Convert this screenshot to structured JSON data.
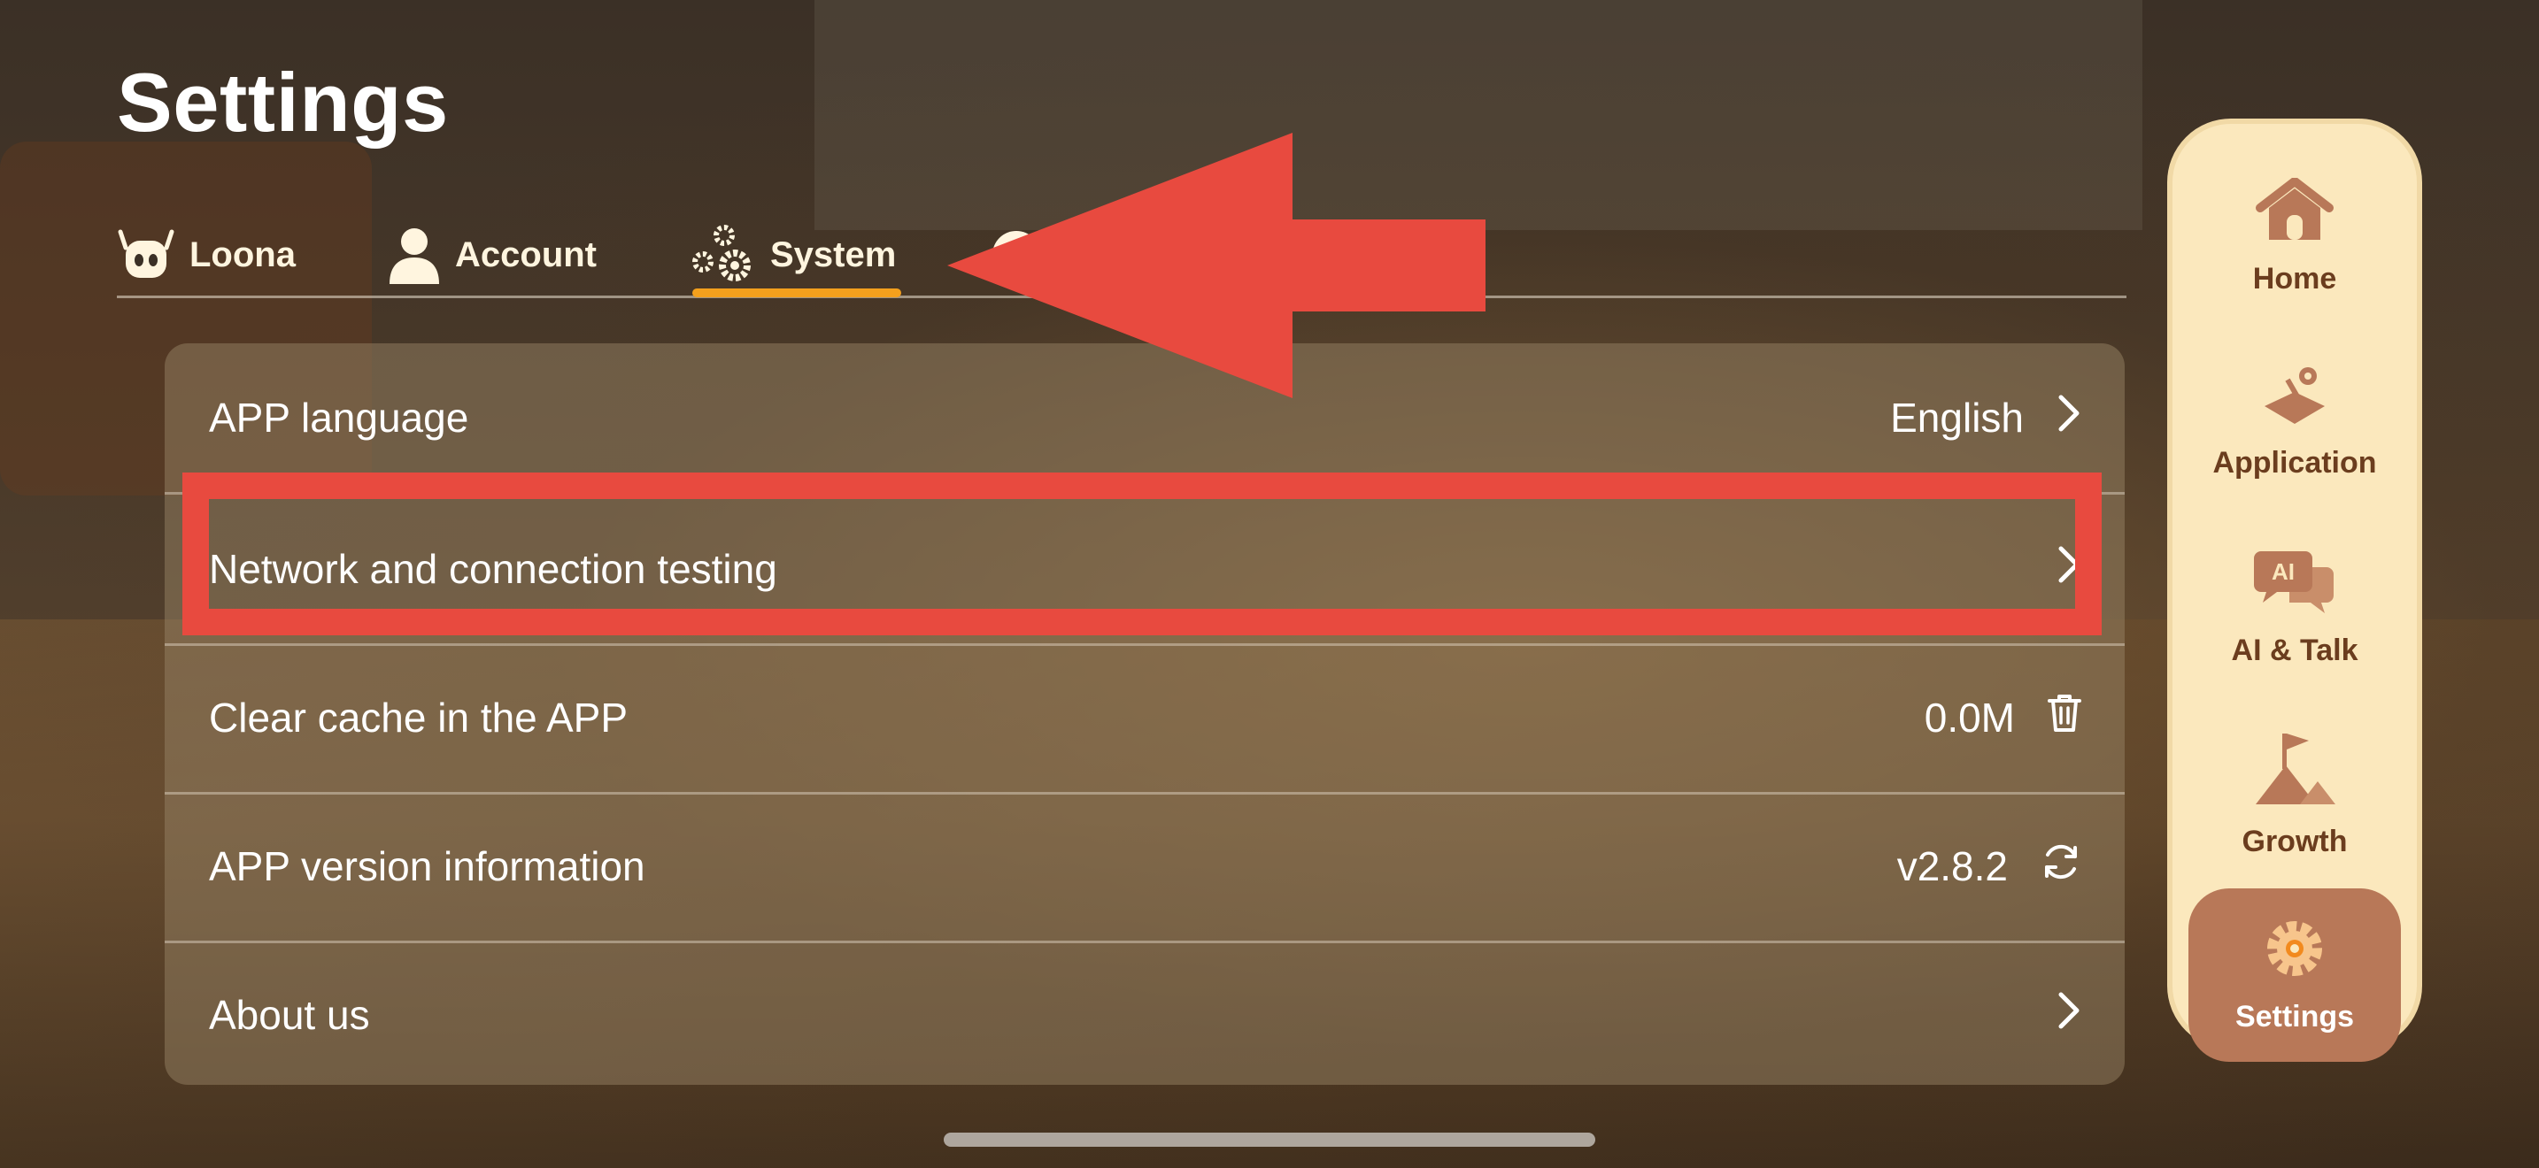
{
  "page": {
    "title": "Settings"
  },
  "tabs": [
    {
      "label": "Loona",
      "icon": "loona-robot-icon"
    },
    {
      "label": "Account",
      "icon": "person-icon"
    },
    {
      "label": "System",
      "icon": "gears-icon",
      "selected": true
    },
    {
      "label": "",
      "icon": "info-icon"
    }
  ],
  "settings": {
    "rows": [
      {
        "label": "APP language",
        "value": "English",
        "icon": "chevron-right-icon"
      },
      {
        "label": "Network and connection testing",
        "value": "",
        "icon": "chevron-right-icon"
      },
      {
        "label": "Clear cache in the APP",
        "value": "0.0M",
        "icon": "trash-icon"
      },
      {
        "label": "APP version information",
        "value": "v2.8.2",
        "icon": "refresh-icon"
      },
      {
        "label": "About us",
        "value": "",
        "icon": "chevron-right-icon"
      }
    ]
  },
  "nav": {
    "items": [
      {
        "label": "Home",
        "icon": "home-icon"
      },
      {
        "label": "Application",
        "icon": "joystick-icon"
      },
      {
        "label": "AI & Talk",
        "icon": "ai-chat-icon"
      },
      {
        "label": "Growth",
        "icon": "flag-mountain-icon"
      },
      {
        "label": "Settings",
        "icon": "gear-icon",
        "active": true
      }
    ]
  },
  "colors": {
    "accent": "#f4a01d",
    "annotation_red": "#e84a3f",
    "nav_background": "#fbe8bd",
    "nav_active": "#b87858",
    "nav_text": "#6b3d1e"
  }
}
